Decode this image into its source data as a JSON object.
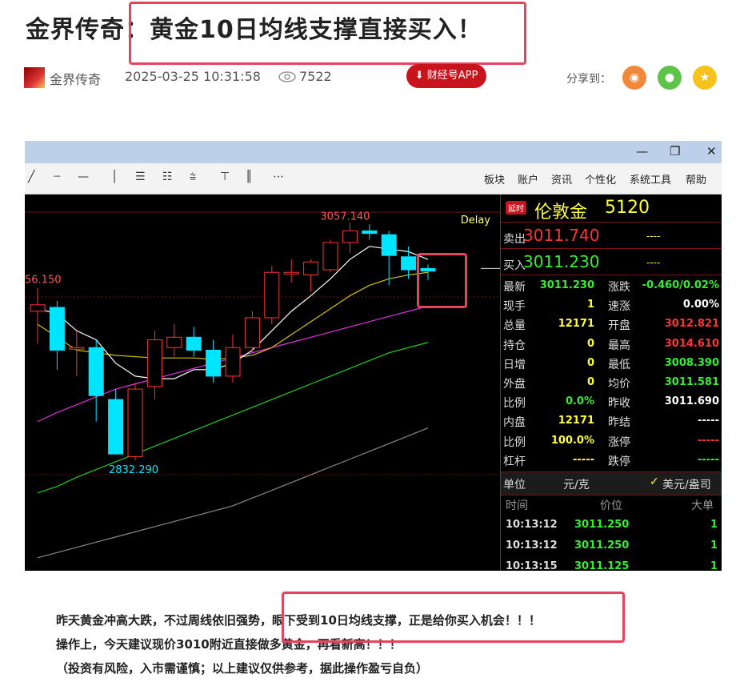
{
  "article": {
    "title": "金界传奇：黄金10日均线支撑直接买入！",
    "author": "金界传奇",
    "date": "2025-03-25 10:31:58",
    "views": "7522",
    "app_button": "财经号APP",
    "share_label": "分享到：",
    "share_icons": [
      "weibo-icon",
      "wechat-icon",
      "favorite-icon"
    ],
    "paragraphs": [
      "昨天黄金冲高大跌，不过周线依旧强势，眼下受到10日均线支撑，正是给你买入机会！！！",
      "操作上，今天建议现价3010附近直接做多黄金，再看新高！！！",
      "（投资有风险，入市需谨慎；以上建议仅供参考，据此操作盈亏自负）"
    ]
  },
  "screenshot": {
    "window_buttons": [
      "—",
      "❐",
      "✕"
    ],
    "menu": [
      "板块",
      "账户",
      "资讯",
      "个性化",
      "系统工具",
      "帮助"
    ],
    "quote": {
      "delay_badge": "延时",
      "name": "伦敦金",
      "code": "5120",
      "sell_label": "卖出",
      "sell_price": "3011.740",
      "sell_extra": "----",
      "buy_label": "买入",
      "buy_price": "3011.230",
      "buy_extra": "----",
      "rows": [
        {
          "l1": "最新",
          "v1": "3011.230",
          "c1": "#33ee33",
          "l2": "涨跌",
          "v2": "-0.460/0.02%",
          "c2": "#33ee33"
        },
        {
          "l1": "现手",
          "v1": "1",
          "c1": "#ffff33",
          "l2": "速涨",
          "v2": "0.00%",
          "c2": "#ffffff"
        },
        {
          "l1": "总量",
          "v1": "12171",
          "c1": "#ffff33",
          "l2": "开盘",
          "v2": "3012.821",
          "c2": "#ff3333"
        },
        {
          "l1": "持仓",
          "v1": "0",
          "c1": "#ffff33",
          "l2": "最高",
          "v2": "3014.610",
          "c2": "#ff3333"
        },
        {
          "l1": "日增",
          "v1": "0",
          "c1": "#ffff33",
          "l2": "最低",
          "v2": "3008.390",
          "c2": "#33ee33"
        },
        {
          "l1": "外盘",
          "v1": "0",
          "c1": "#ffff33",
          "l2": "均价",
          "v2": "3011.581",
          "c2": "#33ee33"
        },
        {
          "l1": "比例",
          "v1": "0.0%",
          "c1": "#33ee33",
          "l2": "昨收",
          "v2": "3011.690",
          "c2": "#ffffff"
        },
        {
          "l1": "内盘",
          "v1": "12171",
          "c1": "#ffff33",
          "l2": "昨结",
          "v2": "-----",
          "c2": "#ffffff"
        },
        {
          "l1": "比例",
          "v1": "100.0%",
          "c1": "#ffff33",
          "l2": "涨停",
          "v2": "-----",
          "c2": "#ff3333"
        },
        {
          "l1": "杠杆",
          "v1": "-----",
          "c1": "#ffff33",
          "l2": "跌停",
          "v2": "-----",
          "c2": "#33ee33"
        }
      ],
      "unit_label": "单位",
      "unit_value": "元/克",
      "currency_toggle": "美元/盎司",
      "ticks_headers": [
        "时间",
        "价位",
        "大单"
      ],
      "ticks": [
        {
          "time": "10:13:12",
          "price": "3011.250",
          "size": "1"
        },
        {
          "time": "10:13:12",
          "price": "3011.250",
          "size": "1"
        },
        {
          "time": "10:13:15",
          "price": "3011.125",
          "size": "1"
        }
      ]
    },
    "chart_data": {
      "type": "candlestick",
      "labels": {
        "high": "3057.140",
        "low": "2832.290",
        "left_edge": "56.150",
        "delay": "Delay"
      },
      "ylim": [
        2790,
        3080
      ],
      "candles": [
        {
          "o": 2990,
          "h": 3008,
          "l": 2965,
          "c": 2995
        },
        {
          "o": 2993,
          "h": 2998,
          "l": 2945,
          "c": 2960
        },
        {
          "o": 2962,
          "h": 2975,
          "l": 2940,
          "c": 2962
        },
        {
          "o": 2962,
          "h": 2968,
          "l": 2905,
          "c": 2925
        },
        {
          "o": 2922,
          "h": 2930,
          "l": 2880,
          "c": 2880
        },
        {
          "o": 2878,
          "h": 2935,
          "l": 2875,
          "c": 2930
        },
        {
          "o": 2932,
          "h": 2975,
          "l": 2922,
          "c": 2968
        },
        {
          "o": 2962,
          "h": 2980,
          "l": 2955,
          "c": 2970
        },
        {
          "o": 2970,
          "h": 2978,
          "l": 2955,
          "c": 2960
        },
        {
          "o": 2960,
          "h": 2968,
          "l": 2935,
          "c": 2940
        },
        {
          "o": 2940,
          "h": 2972,
          "l": 2935,
          "c": 2962
        },
        {
          "o": 2962,
          "h": 2990,
          "l": 2958,
          "c": 2985
        },
        {
          "o": 2985,
          "h": 3025,
          "l": 2980,
          "c": 3020
        },
        {
          "o": 3020,
          "h": 3030,
          "l": 3012,
          "c": 3020
        },
        {
          "o": 3018,
          "h": 3030,
          "l": 3005,
          "c": 3028
        },
        {
          "o": 3022,
          "h": 3045,
          "l": 3020,
          "c": 3043
        },
        {
          "o": 3043,
          "h": 3058,
          "l": 3035,
          "c": 3052
        },
        {
          "o": 3052,
          "h": 3057,
          "l": 3045,
          "c": 3050
        },
        {
          "o": 3049,
          "h": 3052,
          "l": 3010,
          "c": 3033
        },
        {
          "o": 3032,
          "h": 3040,
          "l": 3015,
          "c": 3022
        },
        {
          "o": 3023,
          "h": 3026,
          "l": 3014,
          "c": 3021
        }
      ],
      "ma_white": [
        2992,
        2988,
        2975,
        2968,
        2950,
        2940,
        2938,
        2938,
        2945,
        2945,
        2950,
        2960,
        2975,
        2990,
        3002,
        3015,
        3030,
        3040,
        3038,
        3036,
        3030
      ],
      "ma_yellow": [
        2980,
        2970,
        2960,
        2958,
        2956,
        2955,
        2954,
        2954,
        2954,
        2953,
        2954,
        2956,
        2962,
        2972,
        2982,
        2992,
        3002,
        3010,
        3015,
        3018,
        3020
      ],
      "ma_magenta": [
        2905,
        2912,
        2918,
        2924,
        2930,
        2934,
        2938,
        2942,
        2946,
        2950,
        2954,
        2958,
        2962,
        2966,
        2970,
        2974,
        2978,
        2982,
        2986,
        2990,
        2994
      ],
      "ma_green": [
        2850,
        2855,
        2862,
        2868,
        2874,
        2880,
        2886,
        2892,
        2898,
        2904,
        2910,
        2916,
        2922,
        2928,
        2934,
        2940,
        2946,
        2952,
        2958,
        2962,
        2966
      ],
      "ma_gray": [
        2800,
        2804,
        2808,
        2812,
        2816,
        2820,
        2824,
        2828,
        2832,
        2836,
        2840,
        2846,
        2852,
        2858,
        2864,
        2870,
        2876,
        2882,
        2888,
        2894,
        2900
      ],
      "last_price_line": 3023,
      "colors": {
        "up": "#ff3333",
        "down": "#00e5ff",
        "ma_white": "#ffffff",
        "ma_yellow": "#d8c000",
        "ma_magenta": "#e030e0",
        "ma_green": "#22cc22",
        "ma_gray": "#888888"
      }
    }
  }
}
